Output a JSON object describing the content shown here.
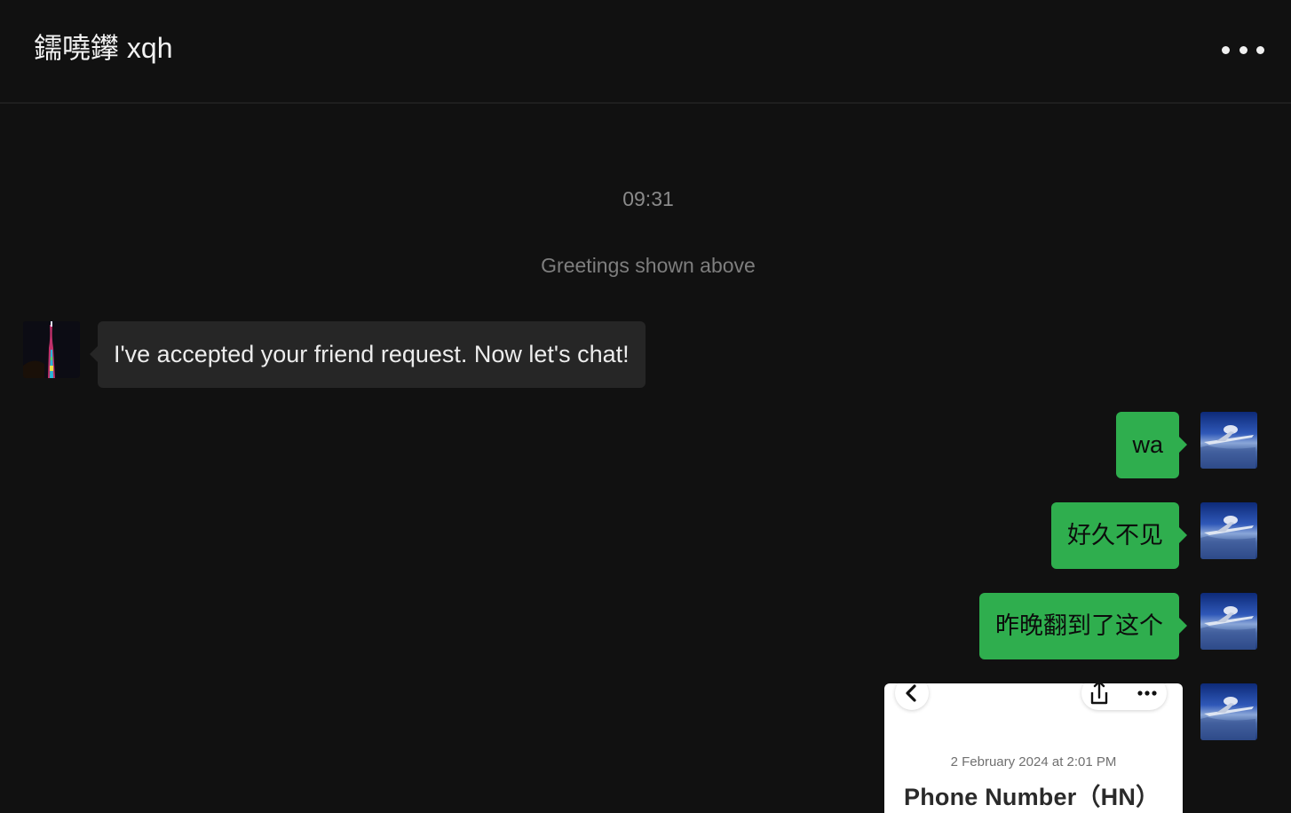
{
  "header": {
    "title": "鑐嘵鑻 xqh",
    "more_icon": "more-horizontal-icon"
  },
  "messages": {
    "timestamp": "09:31",
    "system_note": "Greetings shown above",
    "items": [
      {
        "sender": "contact",
        "avatar": "tower-night-avatar",
        "text": "I've accepted your friend request. Now let's chat!"
      },
      {
        "sender": "me",
        "avatar": "jet-avatar",
        "text": "wa"
      },
      {
        "sender": "me",
        "avatar": "jet-avatar",
        "text": "好久不见"
      },
      {
        "sender": "me",
        "avatar": "jet-avatar",
        "text": "昨晚翻到了这个"
      },
      {
        "sender": "me",
        "avatar": "jet-avatar",
        "type": "image",
        "image": {
          "back_icon": "chevron-left-icon",
          "share_icon": "share-icon",
          "more_icon": "more-horizontal-icon",
          "date": "2 February 2024 at 2:01 PM",
          "title": "Phone Number（HN）"
        }
      }
    ]
  },
  "colors": {
    "background": "#111111",
    "incoming_bubble": "#262626",
    "outgoing_bubble": "#2fae4e"
  }
}
